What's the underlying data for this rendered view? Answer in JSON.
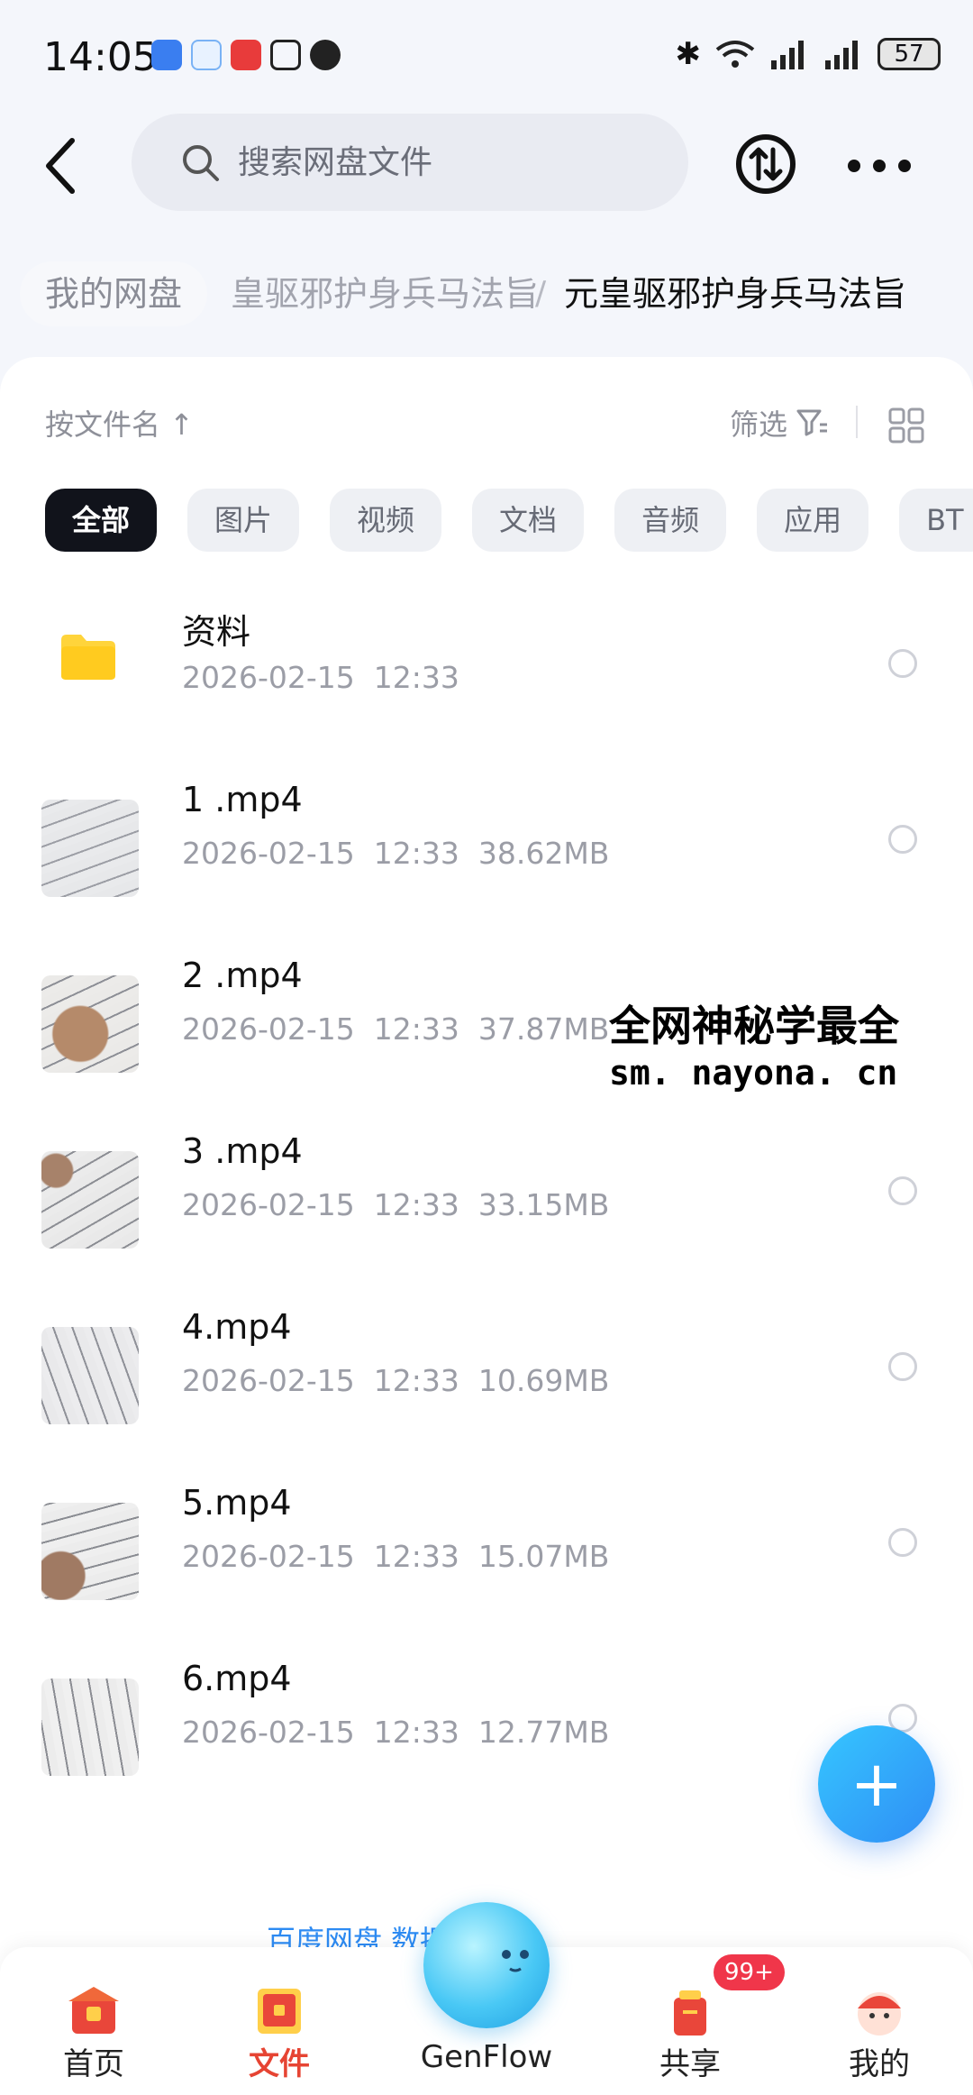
{
  "status_bar": {
    "time": "14:05",
    "battery": "57"
  },
  "search": {
    "placeholder": "搜索网盘文件"
  },
  "breadcrumb": {
    "root": "我的网盘",
    "middle": "皇驱邪护身兵马法旨",
    "separator": "/",
    "current": "元皇驱邪护身兵马法旨"
  },
  "toolbar": {
    "sort_label": "按文件名 ↑",
    "filter_label": "筛选"
  },
  "chips": [
    "全部",
    "图片",
    "视频",
    "文档",
    "音频",
    "应用",
    "BT"
  ],
  "files": [
    {
      "name": "资料",
      "date": "2026-02-15",
      "time": "12:33",
      "size": "",
      "type": "folder"
    },
    {
      "name": "1 .mp4",
      "date": "2026-02-15",
      "time": "12:33",
      "size": "38.62MB",
      "type": "video"
    },
    {
      "name": "2 .mp4",
      "date": "2026-02-15",
      "time": "12:33",
      "size": "37.87MB",
      "type": "video"
    },
    {
      "name": "3 .mp4",
      "date": "2026-02-15",
      "time": "12:33",
      "size": "33.15MB",
      "type": "video"
    },
    {
      "name": "4.mp4",
      "date": "2026-02-15",
      "time": "12:33",
      "size": "10.69MB",
      "type": "video"
    },
    {
      "name": "5.mp4",
      "date": "2026-02-15",
      "time": "12:33",
      "size": "15.07MB",
      "type": "video"
    },
    {
      "name": "6.mp4",
      "date": "2026-02-15",
      "time": "12:33",
      "size": "12.77MB",
      "type": "video"
    }
  ],
  "watermark": {
    "line1": "全网神秘学最全",
    "line2": "sm. nayona. cn"
  },
  "security_notice": "百度网盘 数据安全 ›",
  "nav": {
    "home": "首页",
    "files": "文件",
    "genflow": "GenFlow",
    "share": "共享",
    "share_badge": "99+",
    "mine": "我的"
  },
  "colors": {
    "accent": "#2f8df5",
    "active_nav": "#e64433",
    "folder": "#ffd43b"
  }
}
